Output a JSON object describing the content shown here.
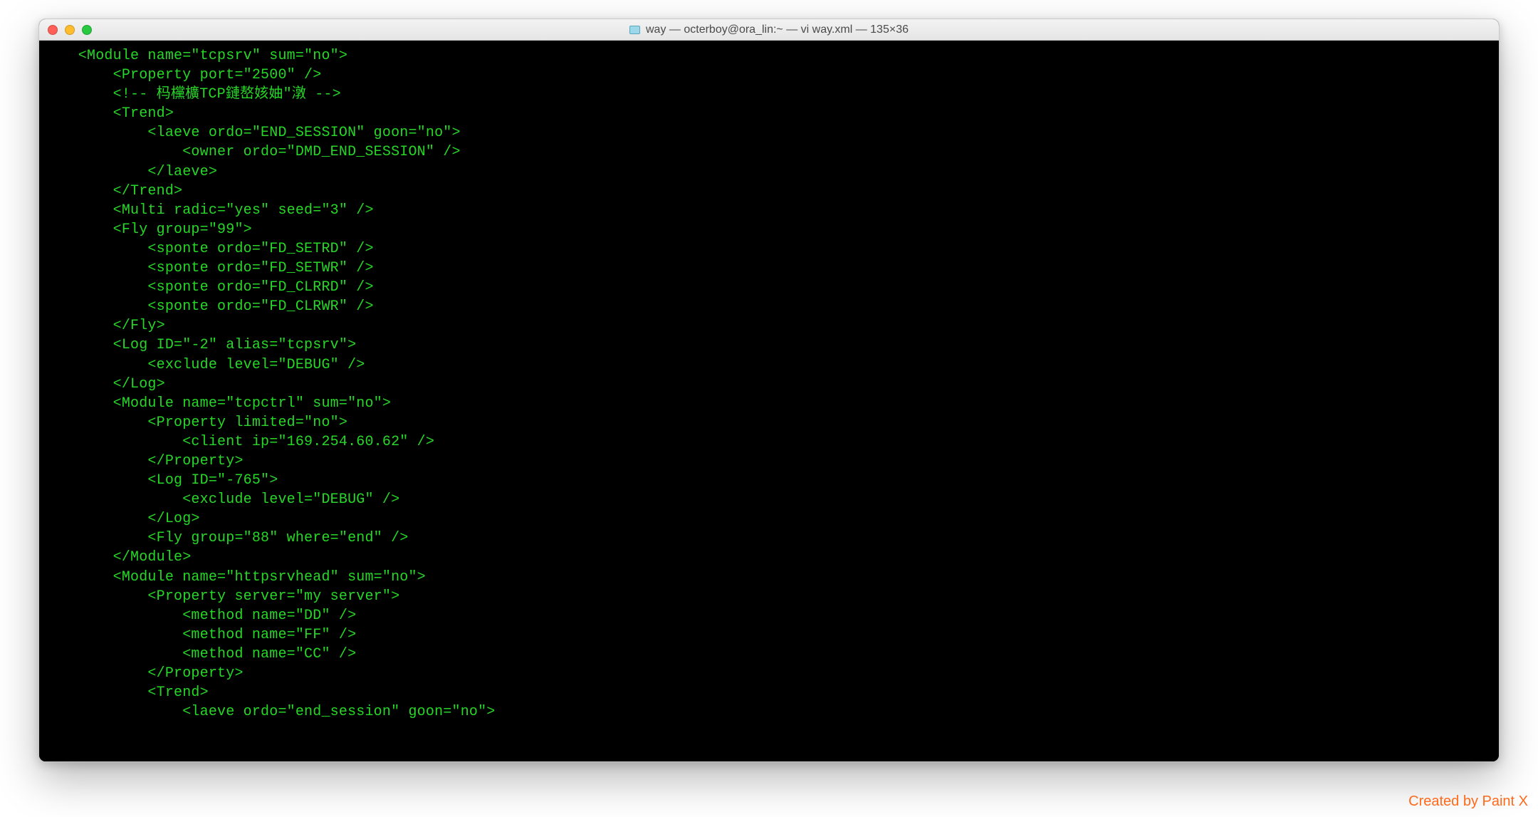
{
  "window": {
    "title": "way — octerboy@ora_lin:~ — vi way.xml — 135×36"
  },
  "terminal": {
    "lines": [
      "    <Module name=\"tcpsrv\" sum=\"no\">",
      "        <Property port=\"2500\" />",
      "        <!-- 杩欓櫎TCP鏈嶅姟妯″潡 -->",
      "        <Trend>",
      "            <laeve ordo=\"END_SESSION\" goon=\"no\">",
      "                <owner ordo=\"DMD_END_SESSION\" />",
      "            </laeve>",
      "        </Trend>",
      "        <Multi radic=\"yes\" seed=\"3\" />",
      "        <Fly group=\"99\">",
      "            <sponte ordo=\"FD_SETRD\" />",
      "            <sponte ordo=\"FD_SETWR\" />",
      "            <sponte ordo=\"FD_CLRRD\" />",
      "            <sponte ordo=\"FD_CLRWR\" />",
      "        </Fly>",
      "        <Log ID=\"-2\" alias=\"tcpsrv\">",
      "            <exclude level=\"DEBUG\" />",
      "        </Log>",
      "        <Module name=\"tcpctrl\" sum=\"no\">",
      "            <Property limited=\"no\">",
      "                <client ip=\"169.254.60.62\" />",
      "            </Property>",
      "            <Log ID=\"-765\">",
      "                <exclude level=\"DEBUG\" />",
      "            </Log>",
      "            <Fly group=\"88\" where=\"end\" />",
      "        </Module>",
      "        <Module name=\"httpsrvhead\" sum=\"no\">",
      "            <Property server=\"my server\">",
      "                <method name=\"DD\" />",
      "                <method name=\"FF\" />",
      "                <method name=\"CC\" />",
      "            </Property>",
      "            <Trend>",
      "                <laeve ordo=\"end_session\" goon=\"no\">"
    ]
  },
  "watermark": "Created by Paint X"
}
